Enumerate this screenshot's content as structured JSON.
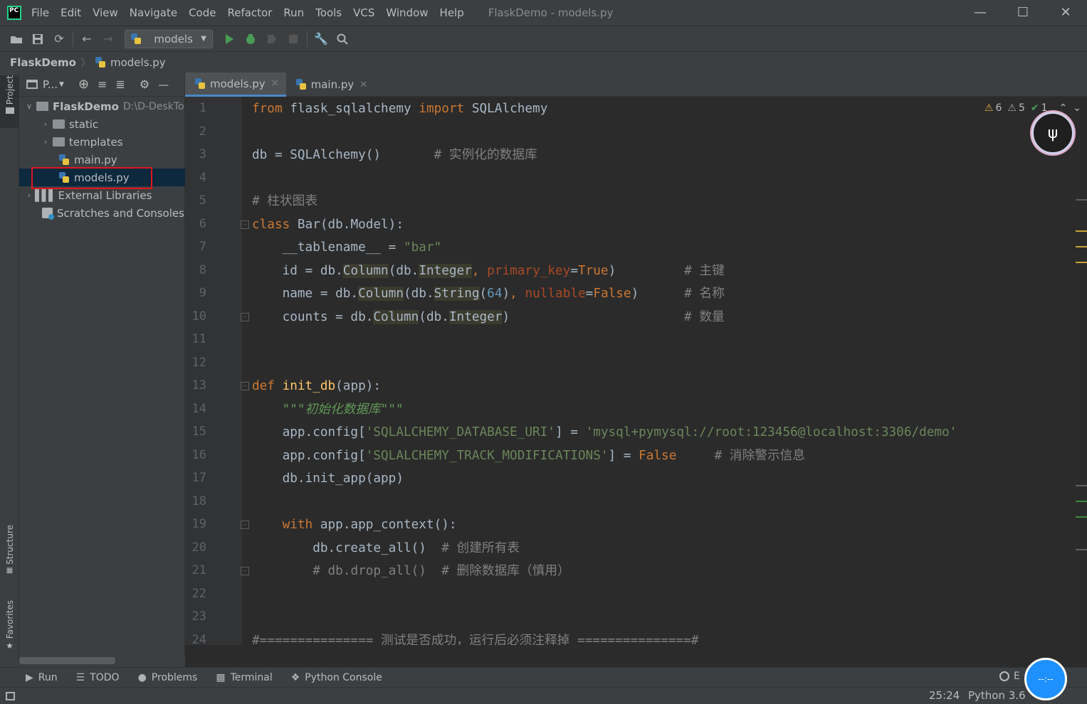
{
  "menu": {
    "items": [
      "File",
      "Edit",
      "View",
      "Navigate",
      "Code",
      "Refactor",
      "Run",
      "Tools",
      "VCS",
      "Window",
      "Help"
    ],
    "window_title": "FlaskDemo - models.py"
  },
  "toolbar": {
    "run_config": "models"
  },
  "breadcrumb": {
    "project": "FlaskDemo",
    "file": "models.py"
  },
  "left_strip": {
    "project_tab": "Project",
    "structure_tab": "Structure",
    "favorites_tab": "Favorites"
  },
  "project_panel": {
    "header_label": "P...",
    "tree": [
      {
        "label": "FlaskDemo",
        "path": "D:\\D-DeskTo"
      },
      {
        "label": "static"
      },
      {
        "label": "templates"
      },
      {
        "label": "main.py"
      },
      {
        "label": "models.py"
      },
      {
        "label": "External Libraries"
      },
      {
        "label": "Scratches and Consoles"
      }
    ]
  },
  "editor": {
    "tabs": [
      {
        "label": "models.py",
        "active": true
      },
      {
        "label": "main.py",
        "active": false
      }
    ],
    "inspections": {
      "warnings": "6",
      "weak_warnings": "5",
      "ok": "1"
    },
    "line_numbers": [
      "1",
      "2",
      "3",
      "4",
      "5",
      "6",
      "7",
      "8",
      "9",
      "10",
      "11",
      "12",
      "13",
      "14",
      "15",
      "16",
      "17",
      "18",
      "19",
      "20",
      "21",
      "22",
      "23",
      "24"
    ],
    "lines": [
      "from flask_sqlalchemy import SQLAlchemy",
      "",
      "db = SQLAlchemy()       # 实例化的数据库",
      "",
      "# 柱状图表",
      "class Bar(db.Model):",
      "    __tablename__ = \"bar\"",
      "    id = db.Column(db.Integer, primary_key=True)         # 主键",
      "    name = db.Column(db.String(64), nullable=False)      # 名称",
      "    counts = db.Column(db.Integer)                       # 数量",
      "",
      "",
      "def init_db(app):",
      "    \"\"\"初始化数据库\"\"\"",
      "    app.config['SQLALCHEMY_DATABASE_URI'] = 'mysql+pymysql://root:123456@localhost:3306/demo'",
      "    app.config['SQLALCHEMY_TRACK_MODIFICATIONS'] = False     # 消除警示信息",
      "    db.init_app(app)",
      "",
      "    with app.app_context():",
      "        db.create_all()  # 创建所有表",
      "        # db.drop_all()  # 删除数据库（慎用）",
      "",
      "",
      "#=============== 测试是否成功，运行后必须注释掉 ===============#"
    ]
  },
  "bottom_tools": [
    "Run",
    "TODO",
    "Problems",
    "Terminal",
    "Python Console"
  ],
  "status": {
    "position": "25:24",
    "interpreter": "Python 3.6",
    "event_log_fragment": "E",
    "bubble_text": "--:--"
  },
  "colors": {
    "keyword": "#cc7832",
    "string": "#6a8759",
    "comment": "#808080",
    "number": "#6897bb",
    "highlight_box": "#e0161e",
    "selection": "#0d293e"
  }
}
